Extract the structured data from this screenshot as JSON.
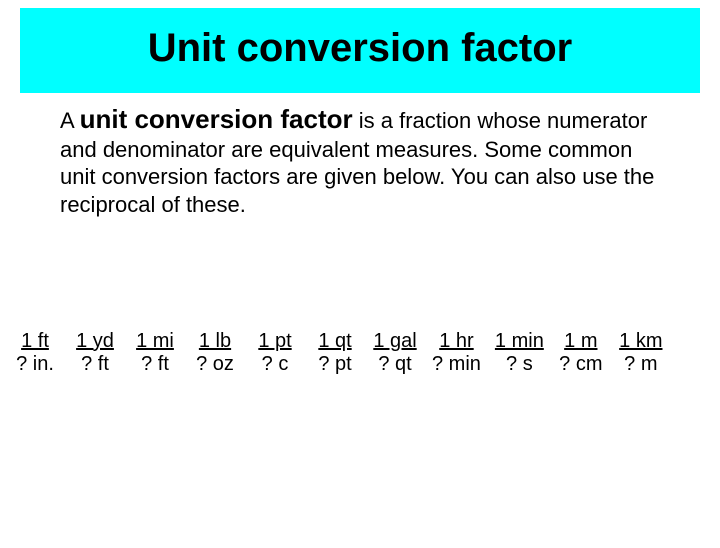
{
  "title": "Unit conversion factor",
  "body": {
    "prefix": "A ",
    "term": "unit conversion factor",
    "rest": " is a fraction whose numerator and denominator are equivalent measures.  Some common unit conversion factors are given below.  You can also use the reciprocal of these."
  },
  "fractions": [
    {
      "num": "1 ft",
      "den": "? in."
    },
    {
      "num": "1 yd",
      "den": "? ft"
    },
    {
      "num": "1 mi",
      "den": "? ft"
    },
    {
      "num": "1 lb",
      "den": "? oz"
    },
    {
      "num": "1 pt",
      "den": "? c"
    },
    {
      "num": "1 qt",
      "den": "? pt"
    },
    {
      "num": "1 gal",
      "den": "? qt"
    },
    {
      "num": "1 hr",
      "den": "? min"
    },
    {
      "num": "1 min",
      "den": "? s"
    },
    {
      "num": "1 m",
      "den": "? cm"
    },
    {
      "num": "1 km",
      "den": "? m"
    }
  ]
}
